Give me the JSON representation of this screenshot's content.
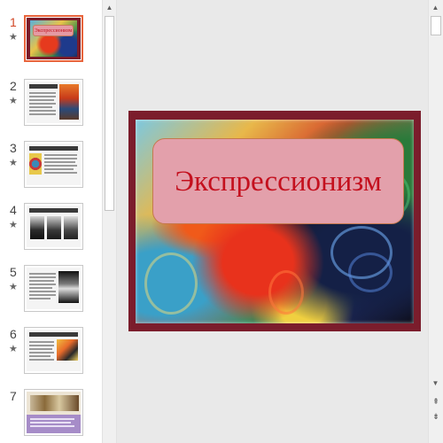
{
  "slides": [
    {
      "number": "1",
      "has_animation": true,
      "active": true,
      "label": "Экспрессионизм"
    },
    {
      "number": "2",
      "has_animation": true,
      "active": false
    },
    {
      "number": "3",
      "has_animation": true,
      "active": false
    },
    {
      "number": "4",
      "has_animation": true,
      "active": false
    },
    {
      "number": "5",
      "has_animation": true,
      "active": false
    },
    {
      "number": "6",
      "has_animation": true,
      "active": false
    },
    {
      "number": "7",
      "has_animation": false,
      "active": false
    }
  ],
  "icons": {
    "animation": "★",
    "scroll_up": "▲",
    "scroll_down": "▼",
    "prev_slide": "⇞",
    "next_slide": "⇟"
  },
  "main_slide": {
    "title": "Экспрессионизм"
  },
  "colors": {
    "active_accent": "#e8643c",
    "slide_background": "#7b1d2c",
    "title_box": "#e3a0ab",
    "title_text": "#c4101e"
  }
}
